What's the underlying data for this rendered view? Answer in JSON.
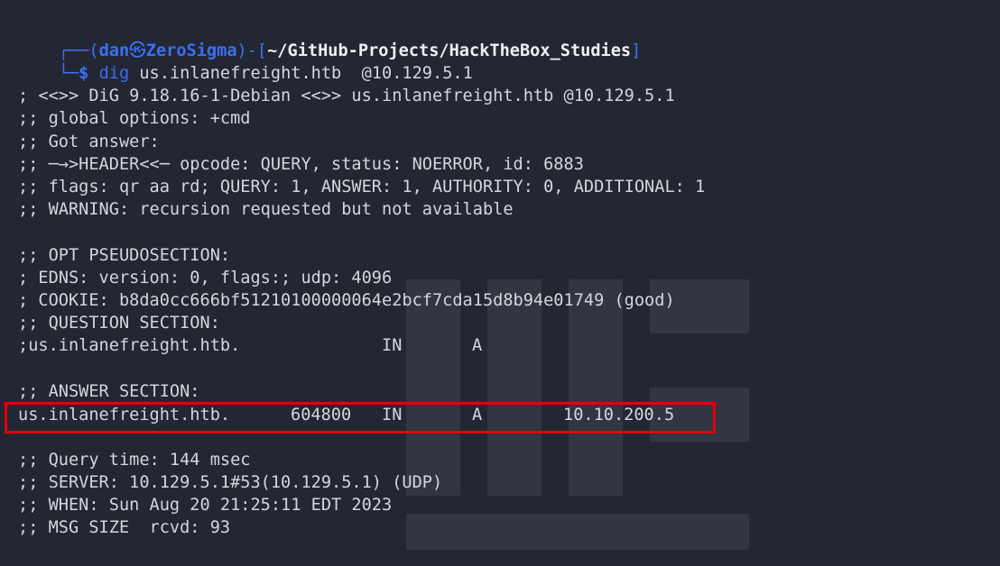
{
  "prompt": {
    "open": "┌──(",
    "user": "dan",
    "skull": "㉿",
    "host": "ZeroSigma",
    "mid": ")-[",
    "path": "~/GitHub-Projects/HackTheBox_Studies",
    "close": "]",
    "corner": "└─",
    "dollar": "$",
    "command": "dig",
    "args": " us.inlanefreight.htb  @10.129.5.1"
  },
  "output": {
    "l1": "; <<>> DiG 9.18.16-1-Debian <<>> us.inlanefreight.htb @10.129.5.1",
    "l2": ";; global options: +cmd",
    "l3": ";; Got answer:",
    "l4": ";; ─→>HEADER<<─ opcode: QUERY, status: NOERROR, id: 6883",
    "l5": ";; flags: qr aa rd; QUERY: 1, ANSWER: 1, AUTHORITY: 0, ADDITIONAL: 1",
    "l6": ";; WARNING: recursion requested but not available",
    "l7": ";; OPT PSEUDOSECTION:",
    "l8": "; EDNS: version: 0, flags:; udp: 4096",
    "l9": "; COOKIE: b8da0cc666bf51210100000064e2bcf7cda15d8b94e01749 (good)",
    "l10": ";; QUESTION SECTION:",
    "question": {
      "name": ";us.inlanefreight.htb.",
      "class": "IN",
      "type": "A"
    },
    "l11": ";; ANSWER SECTION:",
    "answer": {
      "name": "us.inlanefreight.htb.",
      "ttl": "604800",
      "class": "IN",
      "type": "A",
      "address": "10.10.200.5"
    },
    "l12": ";; Query time: 144 msec",
    "l13": ";; SERVER: 10.129.5.1#53(10.129.5.1) (UDP)",
    "l14": ";; WHEN: Sun Aug 20 21:25:11 EDT 2023",
    "l15": ";; MSG SIZE  rcvd: 93"
  },
  "colors": {
    "background": "#232733",
    "prompt_accent": "#3b6ff5",
    "text": "#d4d6dc",
    "highlight_border": "#e0000a"
  }
}
